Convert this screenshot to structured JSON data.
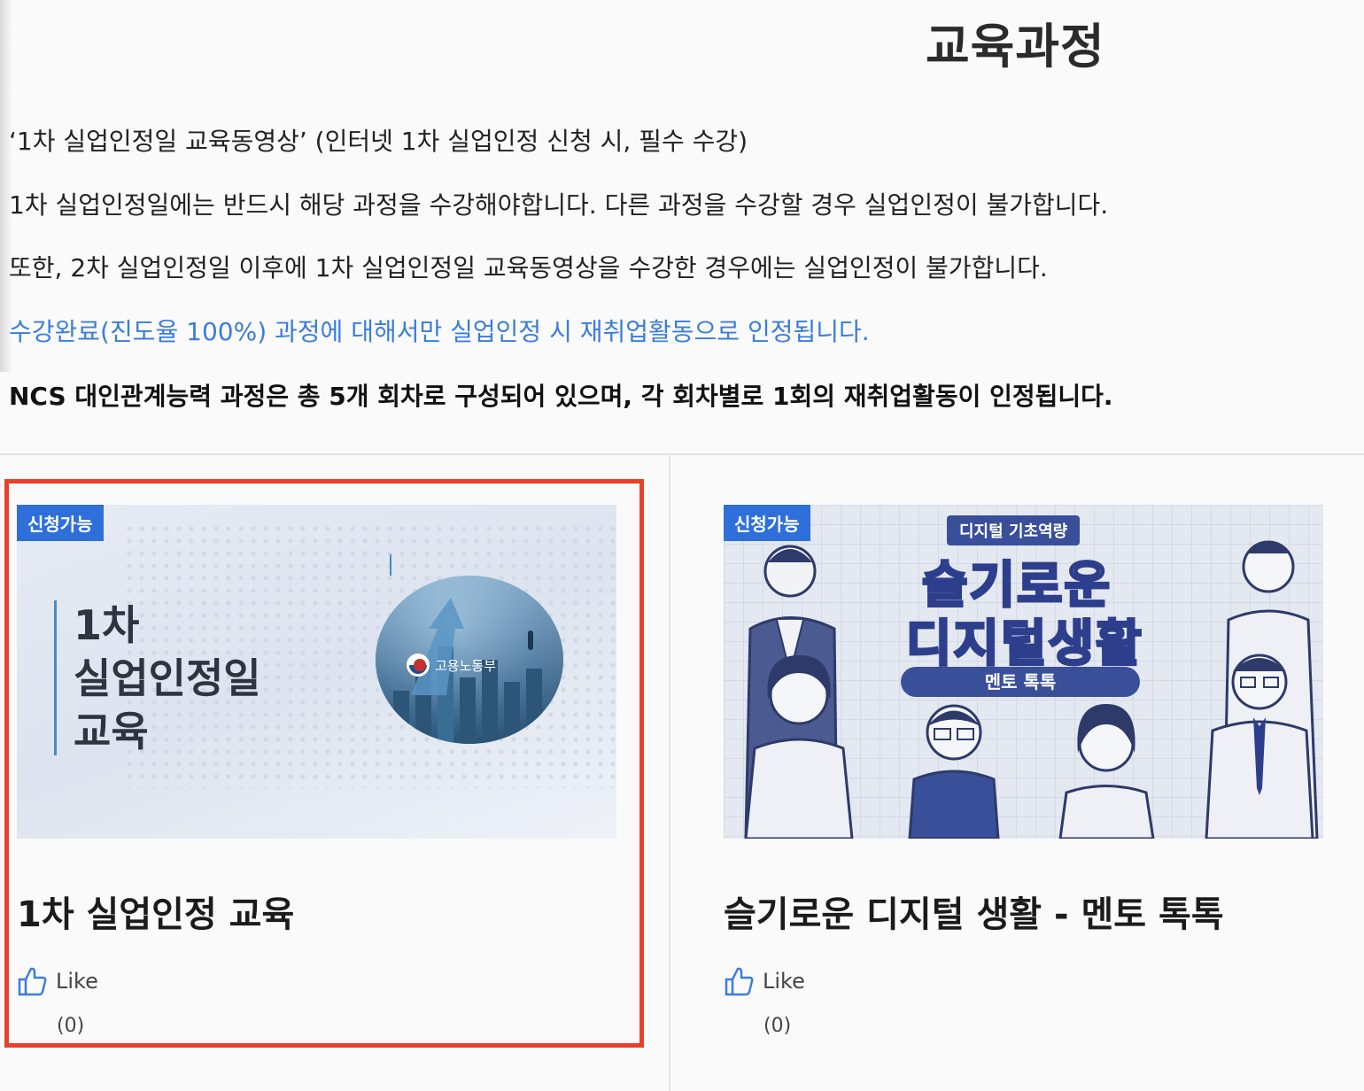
{
  "page": {
    "title": "교육과정"
  },
  "notices": [
    "‘1차 실업인정일 교육동영상’ (인터넷 1차 실업인정 신청 시, 필수 수강)",
    "1차 실업인정일에는 반드시 해당 과정을 수강해야합니다. 다른 과정을 수강할 경우 실업인정이 불가합니다.",
    "또한, 2차 실업인정일 이후에 1차 실업인정일 교육동영상을 수강한 경우에는 실업인정이 불가합니다.",
    "수강완료(진도율 100%) 과정에 대해서만 실업인정 시 재취업활동으로 인정됩니다.",
    "NCS 대인관계능력 과정은 총 5개 회차로 구성되어 있으며, 각 회차별로 1회의 재취업활동이 인정됩니다."
  ],
  "colors": {
    "highlight_border": "#e8402a",
    "badge_bg": "#2f6fd9",
    "notice_accent": "#3b7ddb"
  },
  "courses": [
    {
      "badge": "신청가능",
      "thumbnail_text": "1차\n실업인정일\n교육",
      "thumbnail_logo": "고용노동부",
      "title": "1차 실업인정 교육",
      "like_label": "Like",
      "like_count": "(0)",
      "highlighted": true
    },
    {
      "badge": "신청가능",
      "thumbnail_ribbon": "디지털 기초역량",
      "thumbnail_heading_1": "슬기로운",
      "thumbnail_heading_2": "디지털생활",
      "thumbnail_pill": "멘토 톡톡",
      "title": "슬기로운 디지털 생활 - 멘토 톡톡",
      "like_label": "Like",
      "like_count": "(0)",
      "highlighted": false
    }
  ]
}
